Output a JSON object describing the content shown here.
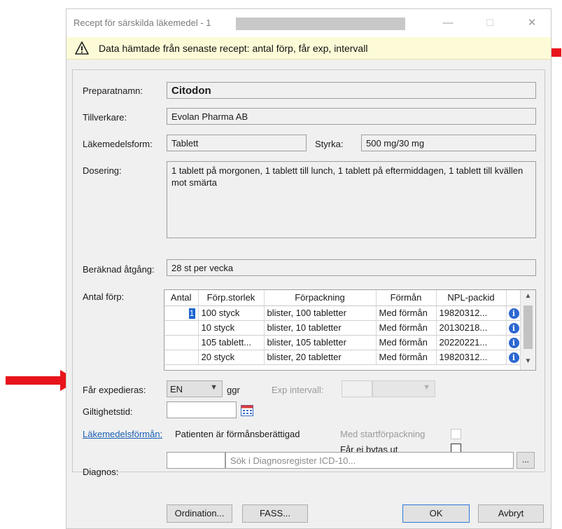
{
  "window": {
    "title": "Recept för särskilda läkemedel - 1",
    "controls": {
      "minimize": "—",
      "maximize": "☐",
      "close": "✕"
    }
  },
  "info_bar": {
    "icon": "warning-icon",
    "text": "Data hämtade från senaste recept: antal förp, får exp, intervall"
  },
  "form": {
    "preparat_label": "Preparatnamn:",
    "preparat_value": "Citodon",
    "tillverkare_label": "Tillverkare:",
    "tillverkare_value": "Evolan Pharma AB",
    "form_label": "Läkemedelsform:",
    "form_value": "Tablett",
    "styrka_label": "Styrka:",
    "styrka_value": "500 mg/30 mg",
    "dosering_label": "Dosering:",
    "dosering_value": "1 tablett på morgonen, 1 tablett till lunch, 1 tablett på eftermiddagen, 1 tablett till kvällen mot smärta",
    "atgang_label": "Beräknad åtgång:",
    "atgang_value": "28 st per vecka",
    "antal_forp_label": "Antal förp:"
  },
  "package_table": {
    "headers": [
      "Antal",
      "Förp.storlek",
      "Förpackning",
      "Förmån",
      "NPL-packid"
    ],
    "selected_antal": "1",
    "rows": [
      {
        "antal": "1",
        "storlek": "100 styck",
        "forpackning": "blister, 100 tabletter",
        "forman": "Med förmån",
        "npl": "19820312..."
      },
      {
        "antal": "",
        "storlek": "10 styck",
        "forpackning": "blister, 10 tabletter",
        "forman": "Med förmån",
        "npl": "20130218..."
      },
      {
        "antal": "",
        "storlek": "105 tablett...",
        "forpackning": "blister, 105 tabletter",
        "forman": "Med förmån",
        "npl": "20220221..."
      },
      {
        "antal": "",
        "storlek": "20 styck",
        "forpackning": "blister, 20 tabletter",
        "forman": "Med förmån",
        "npl": "19820312..."
      }
    ]
  },
  "expedition": {
    "label": "Får expedieras:",
    "value": "EN",
    "unit": "ggr",
    "interval_label": "Exp intervall:",
    "interval_value": "",
    "interval_unit": ""
  },
  "giltighet": {
    "label": "Giltighetstid:",
    "value": "",
    "calendar_icon": "calendar-icon"
  },
  "forman": {
    "link": "Läkemedelsförmån:",
    "value": "Patienten är förmånsberättigad",
    "startforp_label": "Med startförpackning",
    "byte_label": "Får ej bytas ut"
  },
  "diagnos": {
    "label": "Diagnos:",
    "code": "",
    "search_placeholder": "Sök i Diagnosregister ICD-10...",
    "browse_label": "..."
  },
  "buttons": {
    "ordination": "Ordination...",
    "fass": "FASS...",
    "ok": "OK",
    "avbryt": "Avbryt"
  },
  "colors": {
    "info_bar_bg": "#fdfbd7",
    "annotation_arrow": "#e8141b",
    "selection": "#1a64d0",
    "info_dot": "#2d67d2",
    "link": "#1a5fb4"
  }
}
